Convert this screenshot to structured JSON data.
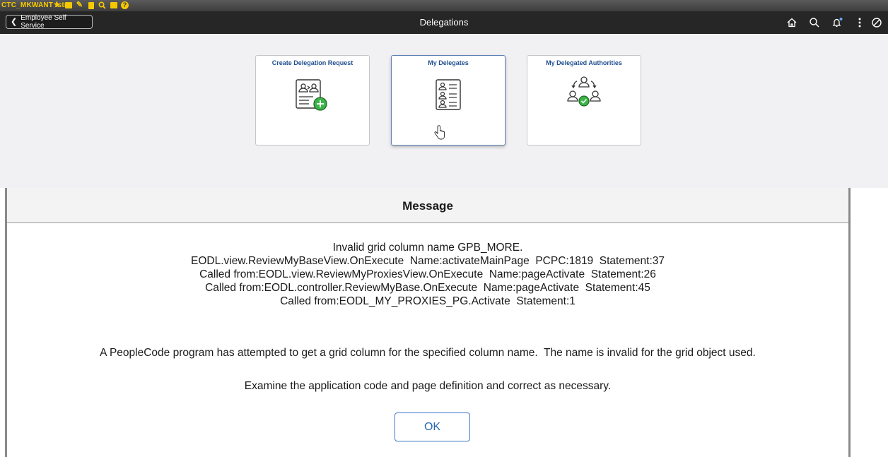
{
  "devbar": {
    "env_label": "CTC_MKWANT fstra",
    "icons": [
      "star-icon",
      "folder-icon",
      "pencil-icon",
      "page-icon",
      "search-icon",
      "refresh-icon",
      "help-icon"
    ]
  },
  "header": {
    "back_label": "Employee Self Service",
    "title": "Delegations",
    "icons": [
      "home-icon",
      "search-icon",
      "notification-bell-icon",
      "actions-menu-icon",
      "navbar-icon"
    ]
  },
  "tiles": [
    {
      "label": "Create Delegation Request",
      "icon": "create-delegation-icon"
    },
    {
      "label": "My Delegates",
      "icon": "delegates-list-icon"
    },
    {
      "label": "My Delegated Authorities",
      "icon": "delegated-authorities-icon"
    }
  ],
  "message": {
    "title": "Message",
    "error_lines": [
      "Invalid grid column name GPB_MORE.",
      "EODL.view.ReviewMyBaseView.OnExecute  Name:activateMainPage  PCPC:1819  Statement:37",
      "Called from:EODL.view.ReviewMyProxiesView.OnExecute  Name:pageActivate  Statement:26",
      "Called from:EODL.controller.ReviewMyBase.OnExecute  Name:pageActivate  Statement:45",
      "Called from:EODL_MY_PROXIES_PG.Activate  Statement:1"
    ],
    "explanation": "A PeopleCode program has attempted to get a grid column for the specified column name.  The name is invalid for the grid object used.",
    "action": "Examine the application code and page definition and correct as necessary.",
    "ok_label": "OK"
  },
  "colors": {
    "header_bg": "#262626",
    "tile_label": "#1f4f8f",
    "accent_green": "#3cb44a",
    "ok_blue": "#2767b0"
  }
}
